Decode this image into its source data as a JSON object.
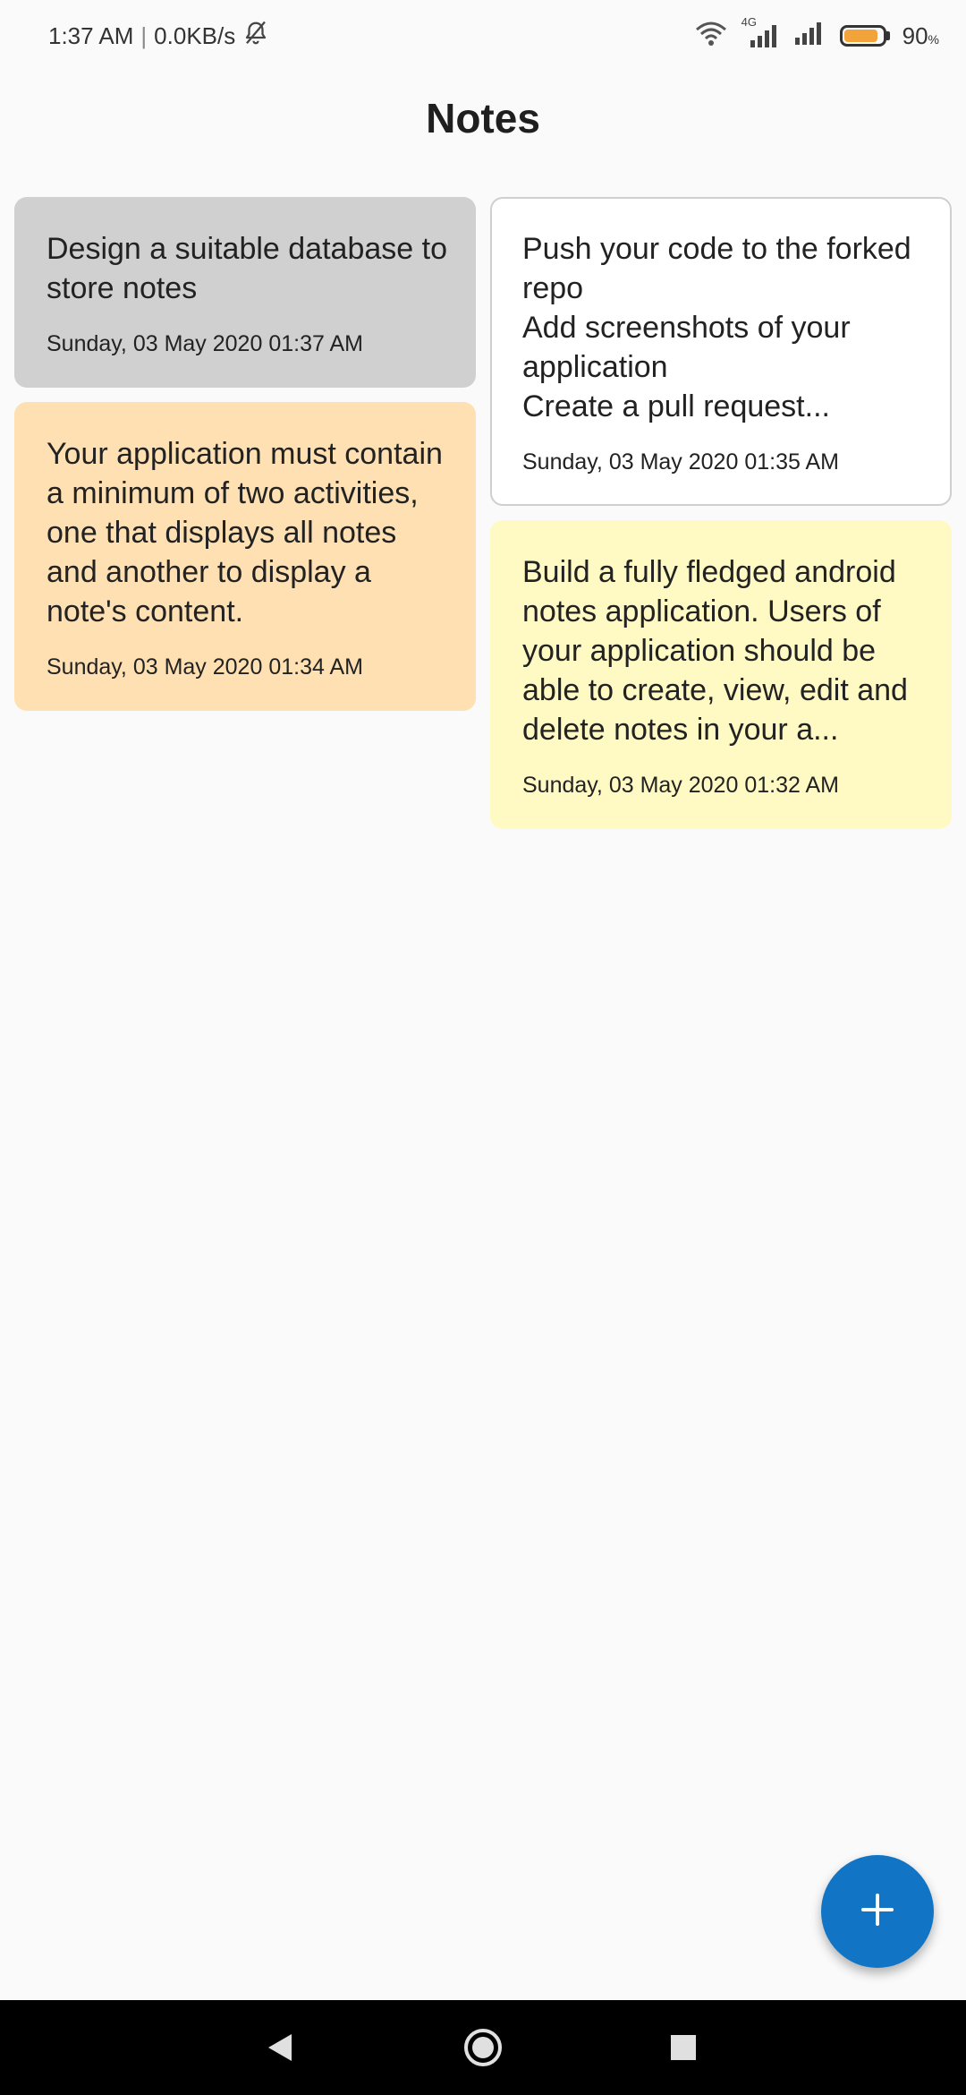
{
  "status_bar": {
    "time": "1:37 AM",
    "separator": "|",
    "network_speed": "0.0KB/s",
    "icons": [
      "bell-off-icon",
      "wifi-icon",
      "signal-4g-icon",
      "signal-icon",
      "battery-icon"
    ],
    "network_type": "4G",
    "battery_level": 0.9,
    "battery_color": "#f2a33a",
    "battery_percent": "90",
    "battery_unit": "%"
  },
  "header": {
    "title": "Notes"
  },
  "notes": {
    "left": [
      {
        "text": "Design a suitable database to store notes",
        "date": "Sunday, 03 May 2020 01:37 AM",
        "color": "#d0d0d0"
      },
      {
        "text": "Your application must contain a minimum of two activities, one that displays all notes and another to display a note's content.",
        "date": "Sunday, 03 May 2020 01:34 AM",
        "color": "#ffe0b2"
      }
    ],
    "right": [
      {
        "text": "Push your code to the forked repo\nAdd screenshots of your application\nCreate a pull request...",
        "date": "Sunday, 03 May 2020 01:35 AM",
        "color": "#ffffff"
      },
      {
        "text": "Build a fully fledged android notes application. Users of your application should be able to create, view, edit and delete notes in your a...",
        "date": "Sunday, 03 May 2020 01:32 AM",
        "color": "#fff9c4"
      }
    ]
  },
  "fab": {
    "icon": "plus-icon",
    "color": "#1274c4"
  },
  "nav_bar": {
    "icons": [
      "back-icon",
      "home-icon",
      "recents-icon"
    ]
  }
}
